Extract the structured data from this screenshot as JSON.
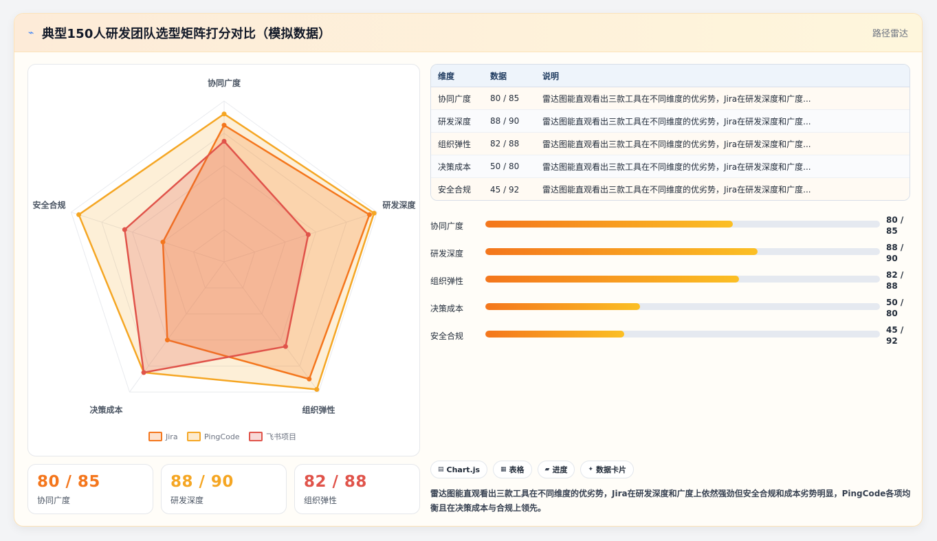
{
  "header": {
    "icon": "bolt-icon",
    "title": "典型150人研发团队选型矩阵打分对比（模拟数据）",
    "tag": "路径雷达"
  },
  "chart_data": {
    "type": "radar",
    "axes": [
      "协同广度",
      "研发深度",
      "组织弹性",
      "决策成本",
      "安全合规"
    ],
    "range": [
      0,
      100
    ],
    "grid": true,
    "legend_position": "bottom",
    "series": [
      {
        "name": "Jira",
        "values": [
          85,
          95,
          90,
          60,
          40
        ],
        "color": "#f4761c"
      },
      {
        "name": "PingCode",
        "values": [
          92,
          98,
          98,
          85,
          95
        ],
        "color": "#f5a623"
      },
      {
        "name": "飞书项目",
        "values": [
          75,
          55,
          65,
          85,
          65
        ],
        "color": "#e0534a"
      }
    ]
  },
  "kpis": [
    {
      "value": "80 / 85",
      "label": "协同广度",
      "color": "#f4761c"
    },
    {
      "value": "88 / 90",
      "label": "研发深度",
      "color": "#f5a623"
    },
    {
      "value": "82 / 88",
      "label": "组织弹性",
      "color": "#e0534a"
    }
  ],
  "table": {
    "headers": [
      "维度",
      "数据",
      "说明"
    ],
    "rows": [
      {
        "dim": "协同广度",
        "data": "80 / 85",
        "desc": "雷达图能直观看出三款工具在不同维度的优劣势，Jira在研发深度和广度..."
      },
      {
        "dim": "研发深度",
        "data": "88 / 90",
        "desc": "雷达图能直观看出三款工具在不同维度的优劣势，Jira在研发深度和广度..."
      },
      {
        "dim": "组织弹性",
        "data": "82 / 88",
        "desc": "雷达图能直观看出三款工具在不同维度的优劣势，Jira在研发深度和广度..."
      },
      {
        "dim": "决策成本",
        "data": "50 / 80",
        "desc": "雷达图能直观看出三款工具在不同维度的优劣势，Jira在研发深度和广度..."
      },
      {
        "dim": "安全合规",
        "data": "45 / 92",
        "desc": "雷达图能直观看出三款工具在不同维度的优劣势，Jira在研发深度和广度..."
      }
    ]
  },
  "progress": [
    {
      "label": "协同广度",
      "value": "80 / 85",
      "fraction": 0.627
    },
    {
      "label": "研发深度",
      "value": "88 / 90",
      "fraction": 0.69
    },
    {
      "label": "组织弹性",
      "value": "82 / 88",
      "fraction": 0.642
    },
    {
      "label": "决策成本",
      "value": "50 / 80",
      "fraction": 0.392
    },
    {
      "label": "安全合规",
      "value": "45 / 92",
      "fraction": 0.352
    }
  ],
  "chips": [
    {
      "icon": "chart-icon",
      "glyph": "▤",
      "label": "Chart.js"
    },
    {
      "icon": "table-icon",
      "glyph": "▦",
      "label": "表格"
    },
    {
      "icon": "progress-icon",
      "glyph": "▰",
      "label": "进度"
    },
    {
      "icon": "card-icon",
      "glyph": "✦",
      "label": "数据卡片"
    }
  ],
  "summary": "雷达图能直观看出三款工具在不同维度的优劣势，Jira在研发深度和广度上依然强劲但安全合规和成本劣势明显，PingCode各项均衡且在决策成本与合规上领先。"
}
